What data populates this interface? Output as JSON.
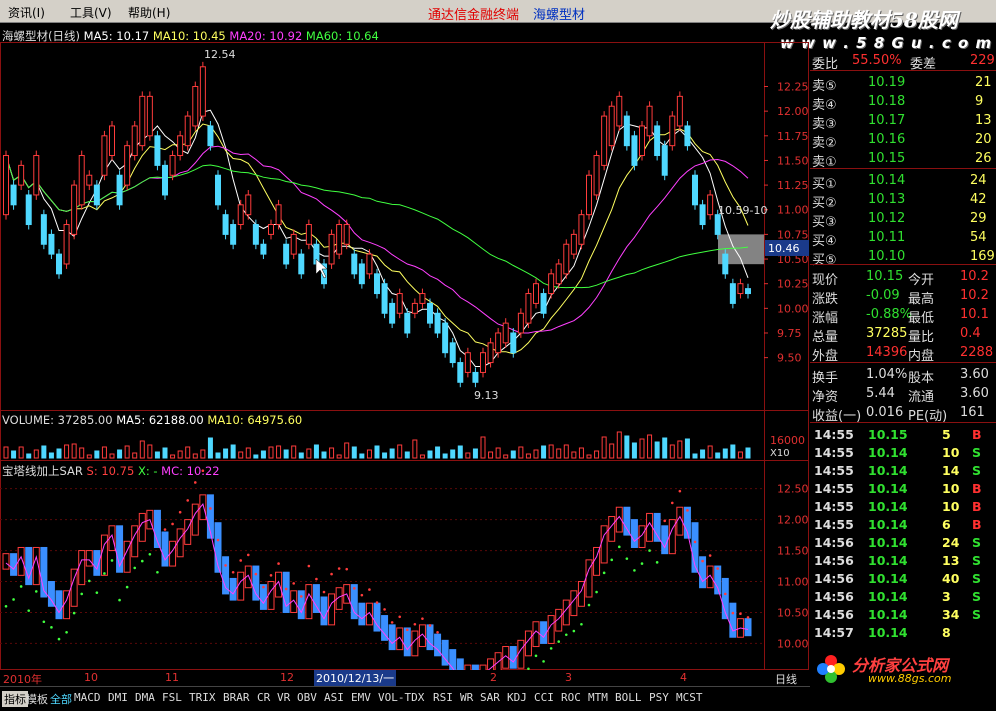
{
  "menu": {
    "items": [
      "资讯(I)",
      "工具(V)",
      "帮助(H)"
    ],
    "brand_red": "通达信金融终端",
    "brand_blue": "海螺型材"
  },
  "watermark": {
    "line1": "炒股辅助教材58股网",
    "line2": "w w w . 5 8 G u . c o m",
    "logo_text": "分析家公式网",
    "logo_url": "www.88gs.com"
  },
  "main_chart": {
    "title": "海螺型材(日线)",
    "ma5": "MA5: 10.17",
    "ma10": "MA10: 10.45",
    "ma20": "MA20: 10.92",
    "ma60": "MA60: 10.64",
    "high_label": "12.54",
    "low_label": "9.13",
    "box_label": "10.59-10",
    "current_tag": "10.46"
  },
  "volume": {
    "vol": "VOLUME: 37285.00",
    "ma5": "MA5: 62188.00",
    "ma10": "MA10: 64975.60",
    "ytick": "16000",
    "unit": "X10"
  },
  "indicator": {
    "title": "宝塔线加上SAR",
    "s": "S: 10.75",
    "x": "X: -",
    "mc": "MC: 10.22"
  },
  "time_axis": {
    "labels": [
      "2010年",
      "10",
      "11",
      "12",
      "2010/12/13/一",
      "2",
      "3",
      "4"
    ],
    "right": "日线"
  },
  "tabs": [
    "指标",
    "模板",
    "全部",
    "MACD",
    "DMI",
    "DMA",
    "FSL",
    "TRIX",
    "BRAR",
    "CR",
    "VR",
    "OBV",
    "ASI",
    "EMV",
    "VOL-TDX",
    "RSI",
    "WR",
    "SAR",
    "KDJ",
    "CCI",
    "ROC",
    "MTM",
    "BOLL",
    "PSY",
    "MCST"
  ],
  "quote": {
    "wb_label": "委比",
    "wb_value": "55.50%",
    "wc_label": "委差",
    "wc_value": "229",
    "sells": [
      {
        "label": "卖⑤",
        "price": "10.19",
        "vol": "21"
      },
      {
        "label": "卖④",
        "price": "10.18",
        "vol": "9"
      },
      {
        "label": "卖③",
        "price": "10.17",
        "vol": "13"
      },
      {
        "label": "卖②",
        "price": "10.16",
        "vol": "20"
      },
      {
        "label": "卖①",
        "price": "10.15",
        "vol": "26"
      }
    ],
    "buys": [
      {
        "label": "买①",
        "price": "10.14",
        "vol": "24"
      },
      {
        "label": "买②",
        "price": "10.13",
        "vol": "42"
      },
      {
        "label": "买③",
        "price": "10.12",
        "vol": "29"
      },
      {
        "label": "买④",
        "price": "10.11",
        "vol": "54"
      },
      {
        "label": "买⑤",
        "price": "10.10",
        "vol": "169"
      }
    ],
    "stats": [
      {
        "l1": "现价",
        "v1": "10.15",
        "l2": "今开",
        "v2": "10.2"
      },
      {
        "l1": "涨跌",
        "v1": "-0.09",
        "l2": "最高",
        "v2": "10.2"
      },
      {
        "l1": "涨幅",
        "v1": "-0.88%",
        "l2": "最低",
        "v2": "10.1"
      },
      {
        "l1": "总量",
        "v1": "37285",
        "l2": "量比",
        "v2": "0.4"
      },
      {
        "l1": "外盘",
        "v1": "14396",
        "l2": "内盘",
        "v2": "2288"
      }
    ],
    "stats2": [
      {
        "l1": "换手",
        "v1": "1.04%",
        "l2": "股本",
        "v2": "3.60"
      },
      {
        "l1": "净资",
        "v1": "5.44",
        "l2": "流通",
        "v2": "3.60"
      },
      {
        "l1": "收益(一)",
        "v1": "0.016",
        "l2": "PE(动)",
        "v2": "161"
      }
    ],
    "ticks": [
      {
        "t": "14:55",
        "p": "10.15",
        "v": "5",
        "s": "B"
      },
      {
        "t": "14:55",
        "p": "10.14",
        "v": "10",
        "s": "S"
      },
      {
        "t": "14:55",
        "p": "10.14",
        "v": "14",
        "s": "S"
      },
      {
        "t": "14:55",
        "p": "10.14",
        "v": "10",
        "s": "B"
      },
      {
        "t": "14:55",
        "p": "10.14",
        "v": "10",
        "s": "B"
      },
      {
        "t": "14:55",
        "p": "10.14",
        "v": "6",
        "s": "B"
      },
      {
        "t": "14:56",
        "p": "10.14",
        "v": "24",
        "s": "S"
      },
      {
        "t": "14:56",
        "p": "10.14",
        "v": "13",
        "s": "S"
      },
      {
        "t": "14:56",
        "p": "10.14",
        "v": "40",
        "s": "S"
      },
      {
        "t": "14:56",
        "p": "10.14",
        "v": "3",
        "s": "S"
      },
      {
        "t": "14:56",
        "p": "10.14",
        "v": "34",
        "s": "S"
      },
      {
        "t": "14:57",
        "p": "10.14",
        "v": "8",
        "s": ""
      }
    ]
  },
  "chart_data": {
    "type": "candlestick",
    "price_axis": {
      "ticks": [
        12.25,
        12.0,
        11.75,
        11.5,
        11.25,
        11.0,
        10.75,
        10.5,
        10.25,
        10.0,
        9.75,
        9.5
      ],
      "ylim": [
        9.05,
        12.6
      ]
    },
    "sar_axis": {
      "ticks": [
        12.5,
        12.0,
        11.5,
        11.0,
        10.5,
        10.0
      ],
      "ylim": [
        9.7,
        12.85
      ]
    },
    "ohlc_trend": [
      [
        10.9,
        11.6
      ],
      [
        11.0,
        11.3
      ],
      [
        11.2,
        11.5
      ],
      [
        10.8,
        11.2
      ],
      [
        11.1,
        11.6
      ],
      [
        10.6,
        11.0
      ],
      [
        10.5,
        10.8
      ],
      [
        10.3,
        10.6
      ],
      [
        10.4,
        10.9
      ],
      [
        10.7,
        11.3
      ],
      [
        11.0,
        11.6
      ],
      [
        11.2,
        11.4
      ],
      [
        11.0,
        11.3
      ],
      [
        11.3,
        11.8
      ],
      [
        11.5,
        11.9
      ],
      [
        11.0,
        11.4
      ],
      [
        11.2,
        11.7
      ],
      [
        11.5,
        11.9
      ],
      [
        11.6,
        12.2
      ],
      [
        11.7,
        12.2
      ],
      [
        11.4,
        11.8
      ],
      [
        11.1,
        11.5
      ],
      [
        11.3,
        11.6
      ],
      [
        11.5,
        11.8
      ],
      [
        11.6,
        12.0
      ],
      [
        11.8,
        12.3
      ],
      [
        11.9,
        12.5
      ],
      [
        11.6,
        11.9
      ],
      [
        11.0,
        11.4
      ],
      [
        10.7,
        11.0
      ],
      [
        10.6,
        10.9
      ],
      [
        10.8,
        11.1
      ],
      [
        10.9,
        11.2
      ],
      [
        10.6,
        10.9
      ],
      [
        10.5,
        10.7
      ],
      [
        10.7,
        10.9
      ],
      [
        10.8,
        11.1
      ],
      [
        10.4,
        10.7
      ],
      [
        10.5,
        10.8
      ],
      [
        10.3,
        10.6
      ],
      [
        10.6,
        10.9
      ],
      [
        10.4,
        10.7
      ],
      [
        10.2,
        10.5
      ],
      [
        10.4,
        10.8
      ],
      [
        10.5,
        10.9
      ],
      [
        10.6,
        10.9
      ],
      [
        10.3,
        10.6
      ],
      [
        10.2,
        10.5
      ],
      [
        10.3,
        10.6
      ],
      [
        10.1,
        10.4
      ],
      [
        9.9,
        10.3
      ],
      [
        9.8,
        10.1
      ],
      [
        9.9,
        10.2
      ],
      [
        9.7,
        10.0
      ],
      [
        9.9,
        10.1
      ],
      [
        10.0,
        10.2
      ],
      [
        9.8,
        10.1
      ],
      [
        9.7,
        10.0
      ],
      [
        9.5,
        9.9
      ],
      [
        9.4,
        9.7
      ],
      [
        9.2,
        9.5
      ],
      [
        9.3,
        9.6
      ],
      [
        9.2,
        9.4
      ],
      [
        9.3,
        9.6
      ],
      [
        9.4,
        9.7
      ],
      [
        9.5,
        9.8
      ],
      [
        9.6,
        9.9
      ],
      [
        9.5,
        9.8
      ],
      [
        9.7,
        10.0
      ],
      [
        9.8,
        10.2
      ],
      [
        10.0,
        10.3
      ],
      [
        9.9,
        10.2
      ],
      [
        10.1,
        10.4
      ],
      [
        10.2,
        10.5
      ],
      [
        10.3,
        10.7
      ],
      [
        10.5,
        10.8
      ],
      [
        10.6,
        11.0
      ],
      [
        10.9,
        11.4
      ],
      [
        11.1,
        11.6
      ],
      [
        11.4,
        12.0
      ],
      [
        11.6,
        12.1
      ],
      [
        11.8,
        12.2
      ],
      [
        11.6,
        12.0
      ],
      [
        11.4,
        11.8
      ],
      [
        11.5,
        11.9
      ],
      [
        11.7,
        12.1
      ],
      [
        11.5,
        11.9
      ],
      [
        11.3,
        11.7
      ],
      [
        11.6,
        12.0
      ],
      [
        11.8,
        12.2
      ],
      [
        11.6,
        11.9
      ],
      [
        11.0,
        11.4
      ],
      [
        10.8,
        11.1
      ],
      [
        10.9,
        11.2
      ],
      [
        10.7,
        11.0
      ],
      [
        10.3,
        10.6
      ],
      [
        10.0,
        10.3
      ],
      [
        10.1,
        10.3
      ],
      [
        10.1,
        10.25
      ]
    ]
  }
}
